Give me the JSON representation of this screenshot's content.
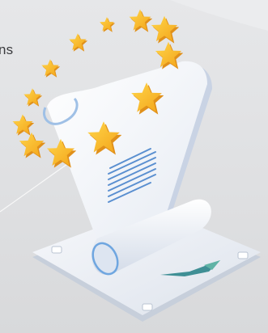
{
  "caption": {
    "text": "ns"
  },
  "illustration": {
    "subject": "scroll-with-star-circle",
    "colors": {
      "background": "#e2e3e5",
      "star": "#f6b51b",
      "star_dark": "#e0901a",
      "paper": "#f4f6fa",
      "paper_shadow": "#c9d3e4",
      "text_lines": "#5a8fd0",
      "check": "#3f8f95",
      "platform": "#eef1f6"
    }
  }
}
